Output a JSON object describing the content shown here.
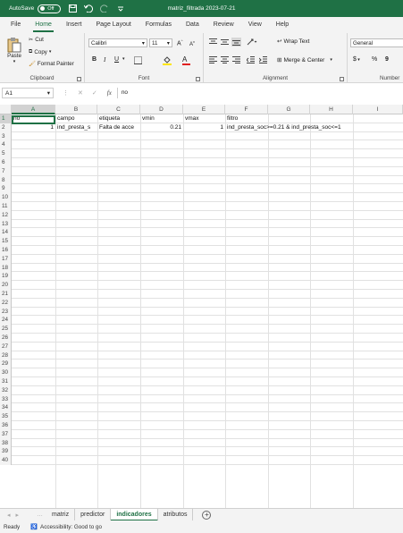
{
  "titlebar": {
    "autosave_label": "AutoSave",
    "toggle_state": "Off",
    "doc_title": "matriz_filtrada 2023-07-21"
  },
  "menu": [
    "File",
    "Home",
    "Insert",
    "Page Layout",
    "Formulas",
    "Data",
    "Review",
    "View",
    "Help"
  ],
  "ribbon": {
    "clipboard": {
      "paste": "Paste",
      "cut": "Cut",
      "copy": "Copy",
      "format_painter": "Format Painter",
      "label": "Clipboard"
    },
    "font": {
      "font_name": "Calibri",
      "font_size": "11",
      "label": "Font",
      "bold": "B",
      "italic": "I",
      "underline": "U",
      "grow": "A",
      "shrink": "A"
    },
    "alignment": {
      "wrap": "Wrap Text",
      "merge": "Merge & Center",
      "label": "Alignment"
    },
    "number": {
      "format": "General",
      "currency": "$",
      "percent": "%",
      "comma": "9",
      "label": "Number"
    }
  },
  "formula": {
    "cell_ref": "A1",
    "fx": "fx",
    "content": "no"
  },
  "columns": [
    "A",
    "B",
    "C",
    "D",
    "E",
    "F",
    "G",
    "H",
    "I"
  ],
  "rows": [
    "1",
    "2",
    "3",
    "4",
    "5",
    "6",
    "7",
    "8",
    "9",
    "10",
    "11",
    "12",
    "13",
    "14",
    "15",
    "16",
    "17",
    "18",
    "19",
    "20",
    "21",
    "22",
    "23",
    "24",
    "25",
    "26",
    "27",
    "28",
    "29",
    "30",
    "31",
    "32",
    "33",
    "34",
    "35",
    "36",
    "37",
    "38",
    "39",
    "40"
  ],
  "cells": {
    "r1": {
      "a": "no",
      "b": "campo",
      "c": "etiqueta",
      "d": "vmin",
      "e": "vmax",
      "f": "filtro"
    },
    "r2": {
      "a": "1",
      "b": "ind_presta_s",
      "c": "Falta de acce",
      "d": "0.21",
      "e": "1",
      "f": "ind_presta_soc>=0.21 & ind_presta_soc<=1"
    }
  },
  "sheets": [
    "matriz",
    "predictor",
    "indicadores",
    "atributos"
  ],
  "active_sheet": "indicadores",
  "status": {
    "ready": "Ready",
    "accessibility": "Accessibility: Good to go"
  },
  "colors": {
    "brand": "#1f7145",
    "ribbon_bg": "#f3f3f3"
  }
}
